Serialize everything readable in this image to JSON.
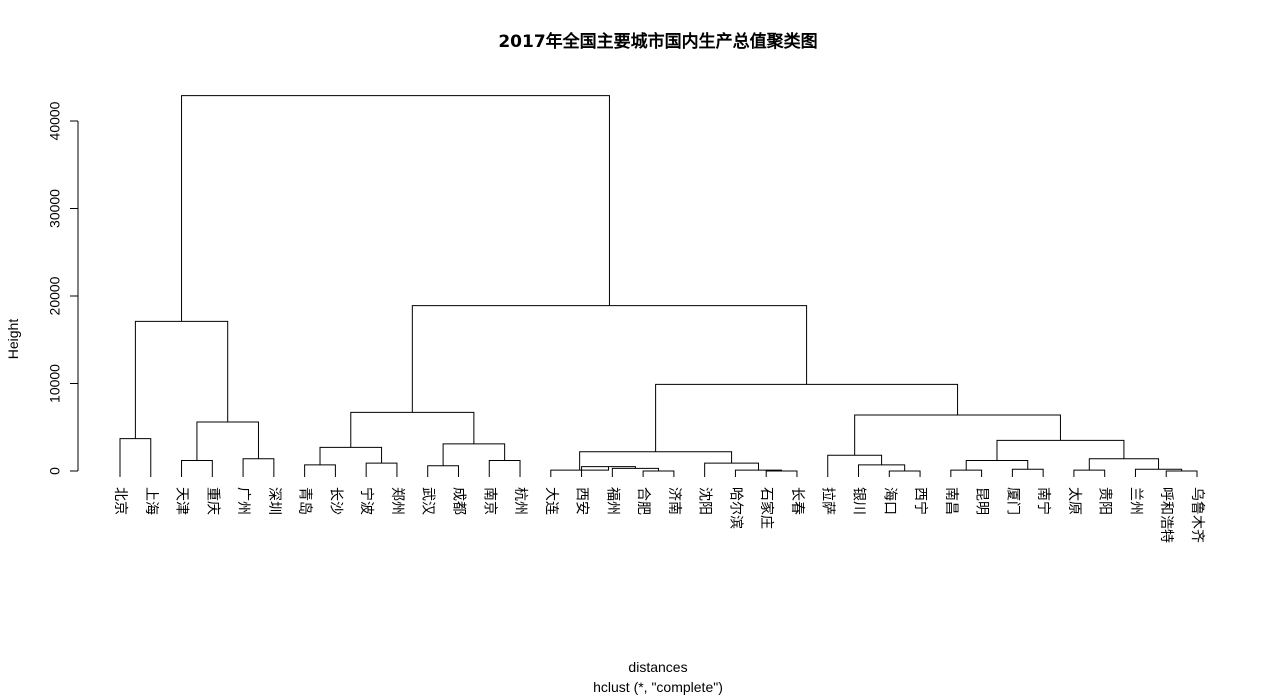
{
  "chart_data": {
    "type": "dendrogram",
    "title": "2017年全国主要城市国内生产总值聚类图",
    "ylabel": "Height",
    "xlabel": "distances",
    "sublabel": "hclust (*, \"complete\")",
    "ylim": [
      0,
      45000
    ],
    "yticks": [
      0,
      10000,
      20000,
      30000,
      40000
    ],
    "ytick_labels": [
      "0",
      "10000",
      "20000",
      "30000",
      "40000"
    ],
    "leaves": [
      "北京",
      "上海",
      "天津",
      "重庆",
      "广州",
      "深圳",
      "青岛",
      "长沙",
      "宁波",
      "郑州",
      "武汉",
      "成都",
      "南京",
      "杭州",
      "大连",
      "西安",
      "福州",
      "合肥",
      "济南",
      "沈阳",
      "哈尔滨",
      "石家庄",
      "长春",
      "拉萨",
      "银川",
      "海口",
      "西宁",
      "南昌",
      "昆明",
      "厦门",
      "南宁",
      "太原",
      "贵阳",
      "兰州",
      "呼和浩特",
      "乌鲁木齐"
    ],
    "merges": [
      {
        "left": "北京",
        "right": "上海",
        "height": 3700
      },
      {
        "left": "天津",
        "right": "重庆",
        "height": 1200
      },
      {
        "left": "广州",
        "right": "深圳",
        "height": 1400
      },
      {
        "left": 1,
        "right": 2,
        "height": 5600
      },
      {
        "left": 0,
        "right": 3,
        "height": 17100
      },
      {
        "left": "青岛",
        "right": "长沙",
        "height": 700
      },
      {
        "left": "宁波",
        "right": "郑州",
        "height": 900
      },
      {
        "left": 5,
        "right": 6,
        "height": 2700
      },
      {
        "left": "武汉",
        "right": "成都",
        "height": 600
      },
      {
        "left": "南京",
        "right": "杭州",
        "height": 1200
      },
      {
        "left": 8,
        "right": 9,
        "height": 3100
      },
      {
        "left": 7,
        "right": 10,
        "height": 6700
      },
      {
        "left": "合肥",
        "right": "济南",
        "height": 0
      },
      {
        "left": "福州",
        "right": 12,
        "height": 300
      },
      {
        "left": "西安",
        "right": 13,
        "height": 500
      },
      {
        "left": "大连",
        "right": 14,
        "height": 100
      },
      {
        "left": "石家庄",
        "right": "长春",
        "height": 0
      },
      {
        "left": "哈尔滨",
        "right": 16,
        "height": 100
      },
      {
        "left": "沈阳",
        "right": 17,
        "height": 900
      },
      {
        "left": 15,
        "right": 18,
        "height": 2200
      },
      {
        "left": "海口",
        "right": "西宁",
        "height": 0
      },
      {
        "left": "银川",
        "right": 20,
        "height": 700
      },
      {
        "left": "拉萨",
        "right": 21,
        "height": 1800
      },
      {
        "left": "南昌",
        "right": "昆明",
        "height": 100
      },
      {
        "left": "厦门",
        "right": "南宁",
        "height": 200
      },
      {
        "left": 23,
        "right": 24,
        "height": 1200
      },
      {
        "left": "太原",
        "right": "贵阳",
        "height": 100
      },
      {
        "left": "呼和浩特",
        "right": "乌鲁木齐",
        "height": 0
      },
      {
        "left": "兰州",
        "right": 27,
        "height": 200
      },
      {
        "left": 26,
        "right": 28,
        "height": 1400
      },
      {
        "left": 25,
        "right": 29,
        "height": 3500
      },
      {
        "left": 22,
        "right": 30,
        "height": 6400
      },
      {
        "left": 19,
        "right": 31,
        "height": 9900
      },
      {
        "left": 11,
        "right": 32,
        "height": 18900
      },
      {
        "left": 4,
        "right": 33,
        "height": 42900
      }
    ]
  }
}
